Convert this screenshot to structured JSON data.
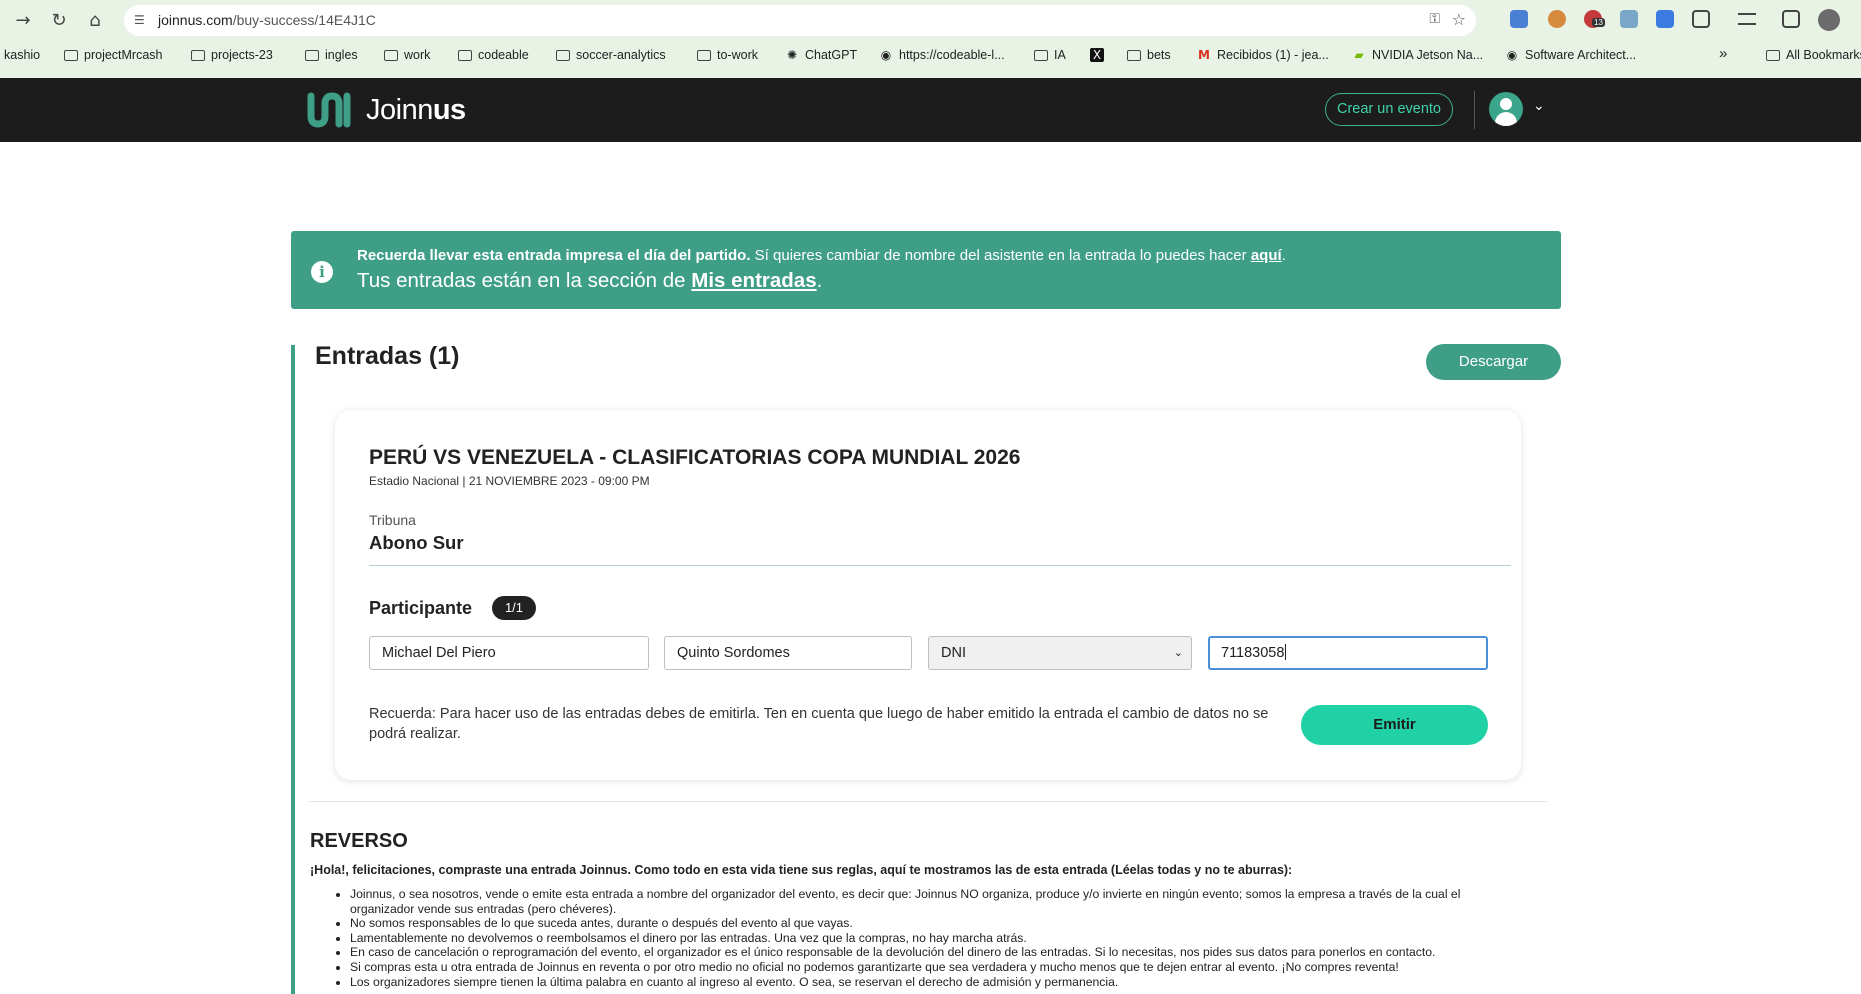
{
  "browser": {
    "url_domain": "joinnus.com",
    "url_path": "/buy-success/14E4J1C",
    "bookmarks": [
      {
        "label": "kashio",
        "icon": "none"
      },
      {
        "label": "projectMrcash",
        "icon": "folder-icon"
      },
      {
        "label": "projects-23",
        "icon": "folder-icon"
      },
      {
        "label": "ingles",
        "icon": "folder-icon"
      },
      {
        "label": "work",
        "icon": "folder-icon"
      },
      {
        "label": "codeable",
        "icon": "folder-icon"
      },
      {
        "label": "soccer-analytics",
        "icon": "folder-icon"
      },
      {
        "label": "to-work",
        "icon": "folder-icon"
      },
      {
        "label": "ChatGPT",
        "icon": "chatgpt-icon"
      },
      {
        "label": "https://codeable-l...",
        "icon": "globe-icon"
      },
      {
        "label": "IA",
        "icon": "folder-icon"
      },
      {
        "label": "",
        "icon": "x-icon"
      },
      {
        "label": "bets",
        "icon": "folder-icon"
      },
      {
        "label": "Recibidos (1) - jea...",
        "icon": "gmail-icon"
      },
      {
        "label": "NVIDIA Jetson Na...",
        "icon": "nvidia-icon"
      },
      {
        "label": "Software Architect...",
        "icon": "globe-icon"
      },
      {
        "label": "All Bookmarks",
        "icon": "folder-icon"
      }
    ],
    "overflow_glyph": "»",
    "extension_badge": "13"
  },
  "header": {
    "logo_light": "Join",
    "logo_n": "n",
    "logo_bold": "us",
    "create_event_label": "Crear un evento"
  },
  "alert": {
    "bold_text": "Recuerda llevar esta entrada impresa el día del partido.",
    "rest_text": " Sí quieres cambiar de nombre del asistente en la entrada lo puedes hacer ",
    "link_here": "aquí",
    "line1_end": ".",
    "line2_prefix": "Tus entradas están en la sección de ",
    "line2_link": "Mis entradas",
    "line2_end": "."
  },
  "tickets": {
    "title": "Entradas (1)",
    "download_label": "Descargar"
  },
  "ticket": {
    "event_title": "PERÚ VS VENEZUELA - CLASIFICATORIAS COPA MUNDIAL 2026",
    "event_meta": "Estadio Nacional | 21 NOVIEMBRE 2023 - 09:00 PM",
    "tribuna_label": "Tribuna",
    "tribuna_value": "Abono Sur",
    "participant_label": "Participante",
    "participant_count": "1/1",
    "first_name": "Michael Del Piero",
    "last_name": "Quinto Sordomes",
    "doc_type": "DNI",
    "doc_number": "71183058",
    "reminder": "Recuerda: Para hacer uso de las entradas debes de emitirla. Ten en cuenta que luego de haber emitido la entrada el cambio de datos no se podrá realizar.",
    "emit_label": "Emitir"
  },
  "reverso": {
    "title": "REVERSO",
    "intro": "¡Hola!, felicitaciones, compraste una entrada Joinnus. Como todo en esta vida tiene sus reglas, aquí te mostramos las de esta entrada (Léelas todas y no te aburras):",
    "rules": [
      "Joinnus, o sea nosotros, vende o emite esta entrada a nombre del organizador del evento, es decir que: Joinnus NO organiza, produce y/o invierte en ningún evento; somos la empresa a través de la cual el organizador vende sus entradas (pero chéveres).",
      "No somos responsables de lo que suceda antes, durante o después del evento al que vayas.",
      "Lamentablemente no devolvemos o reembolsamos el dinero por las entradas. Una vez que la compras, no hay marcha atrás.",
      "En caso de cancelación o reprogramación del evento, el organizador es el único responsable de la devolución del dinero de las entradas. Si lo necesitas, nos pides sus datos para ponerlos en contacto.",
      "Si compras esta u otra entrada de Joinnus en reventa o por otro medio no oficial no podemos garantizarte que sea verdadera y mucho menos que te dejen entrar al evento. ¡No compres reventa!",
      "Los organizadores siempre tienen la última palabra en cuanto al ingreso al evento. O sea, se reservan el derecho de admisión y permanencia."
    ]
  },
  "colors": {
    "brand_green": "#3e9e86",
    "emit_green": "#1fd1a4",
    "header_bg": "#1c1c1c",
    "chrome_bg": "#e8f3e6"
  }
}
